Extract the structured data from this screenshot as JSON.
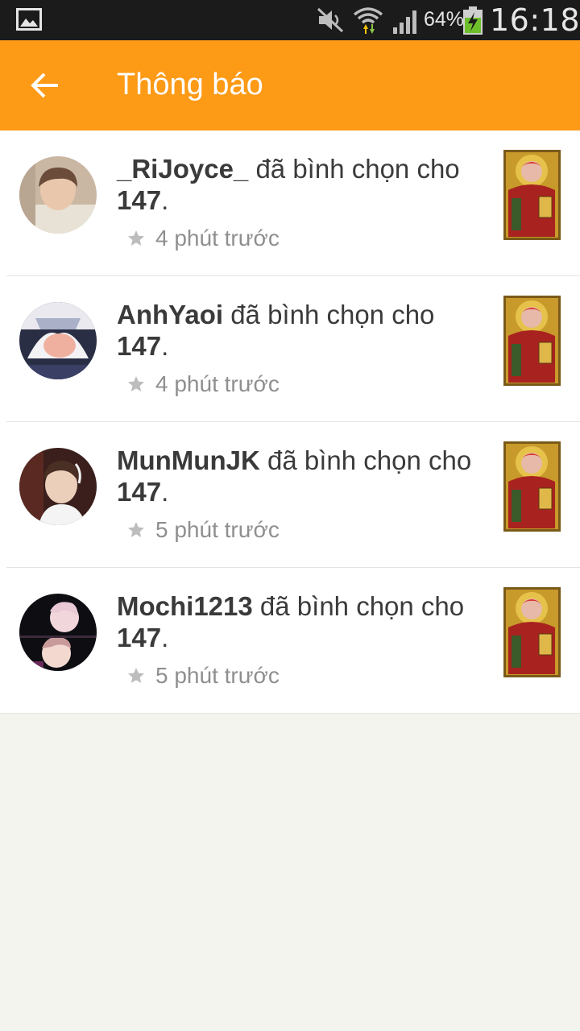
{
  "status_bar": {
    "battery_percent": "64%",
    "time": "16:18",
    "icons": [
      "gallery-icon",
      "mute-icon",
      "wifi-icon",
      "signal-icon",
      "battery-charging-icon"
    ]
  },
  "app_bar": {
    "title": "Thông báo",
    "back_icon": "arrow-left-icon",
    "color": "#fd9a16"
  },
  "notifications": [
    {
      "user": "_RiJoyce_",
      "action": " đã bình chọn cho ",
      "story": "147",
      "end": ".",
      "time": "4 phút trước"
    },
    {
      "user": "AnhYaoi",
      "action": " đã bình chọn cho ",
      "story": "147",
      "end": ".",
      "time": "4 phút trước"
    },
    {
      "user": "MunMunJK",
      "action": " đã bình chọn cho ",
      "story": "147",
      "end": ".",
      "time": "5 phút trước"
    },
    {
      "user": "Mochi1213",
      "action": " đã bình chọn cho ",
      "story": "147",
      "end": ".",
      "time": "5 phút trước"
    }
  ]
}
